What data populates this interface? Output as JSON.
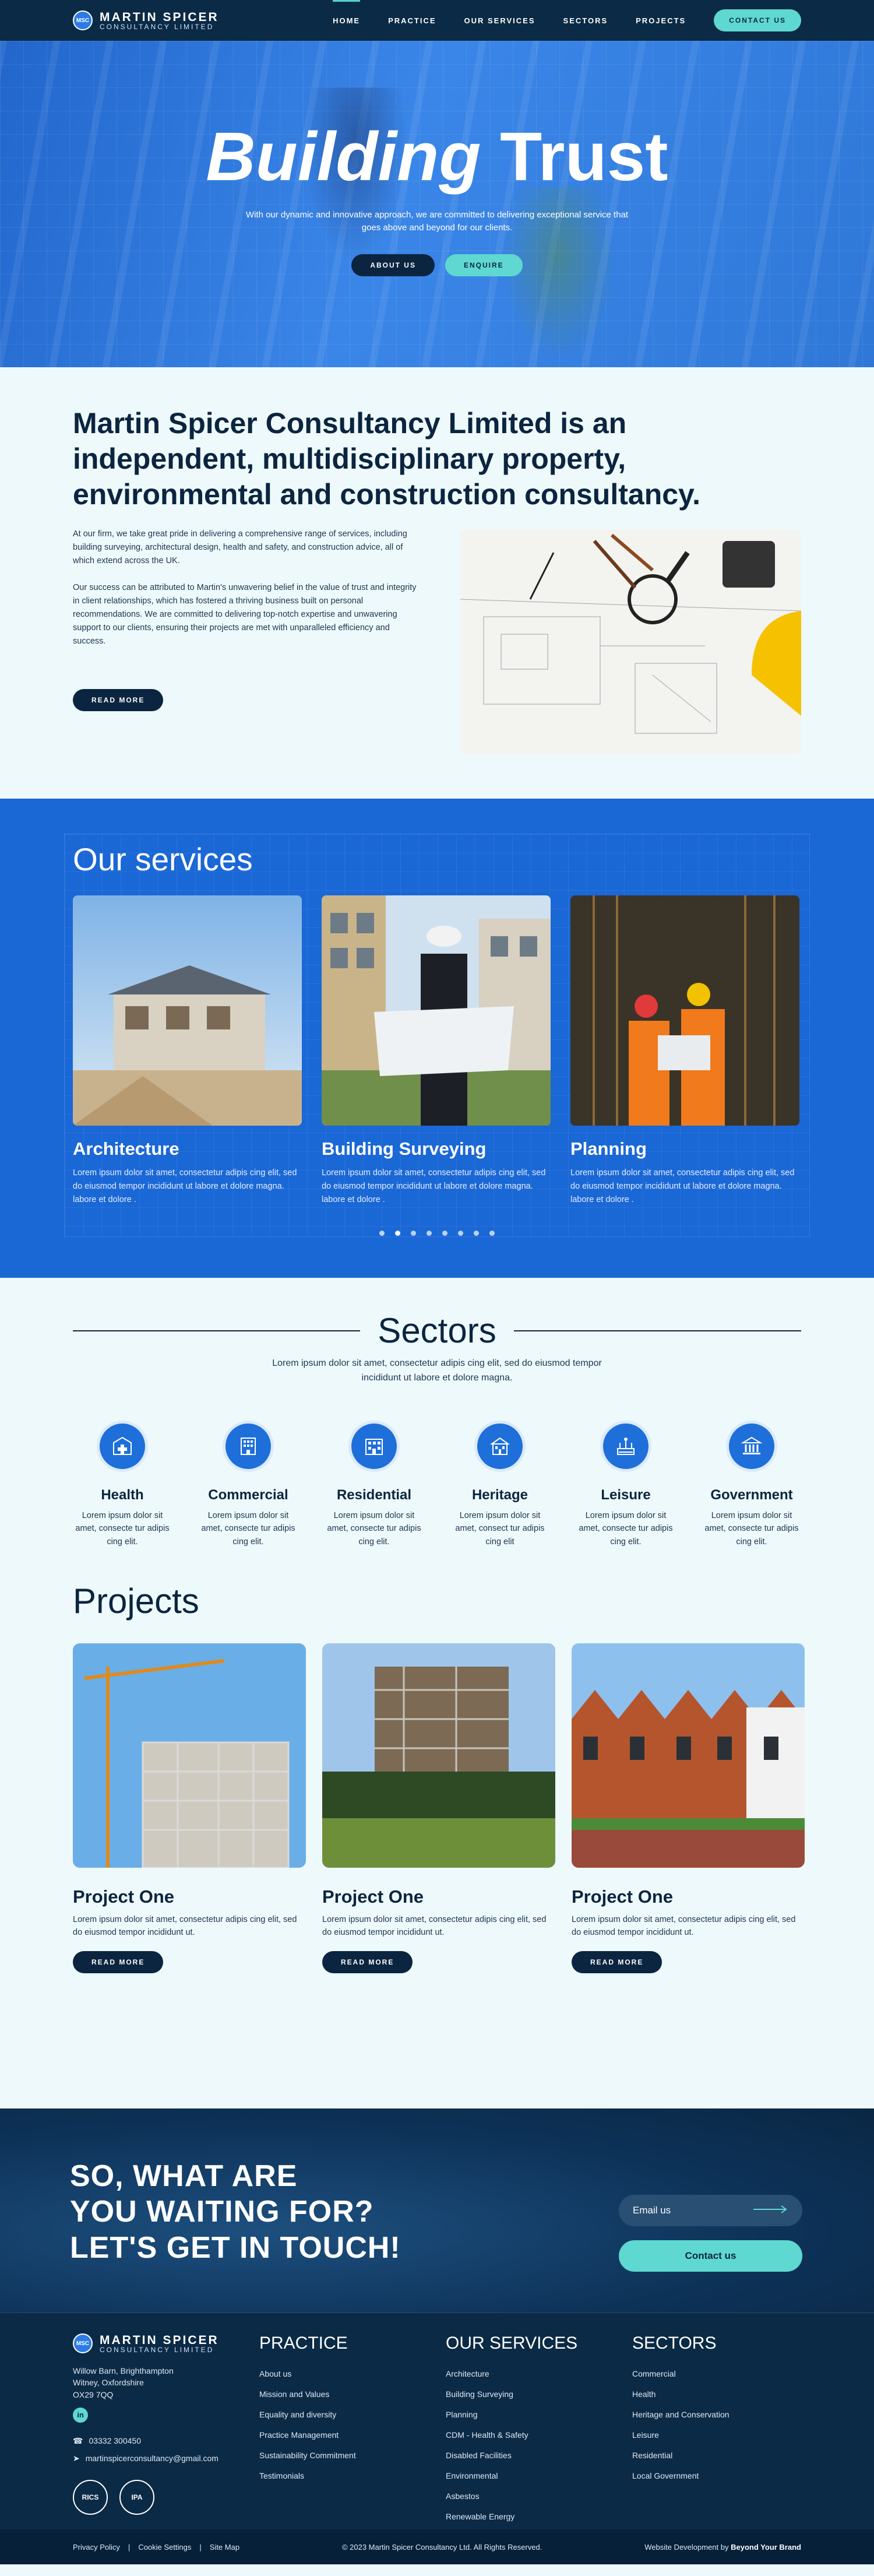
{
  "header": {
    "logo_badge": "MSC",
    "logo_line1": "MARTIN SPICER",
    "logo_line2": "CONSULTANCY LIMITED",
    "nav": [
      "HOME",
      "PRACTICE",
      "OUR SERVICES",
      "SECTORS",
      "PROJECTS"
    ],
    "contact_button": "CONTACT US"
  },
  "hero": {
    "title_italic": "Building",
    "title_rest": "Trust",
    "subtitle": "With our dynamic and innovative approach, we are committed to delivering exceptional service that goes above and beyond for our clients.",
    "button_about": "ABOUT US",
    "button_enquire": "ENQUIRE"
  },
  "about": {
    "heading": "Martin Spicer Consultancy Limited is an independent, multidisciplinary property, environmental and construction consultancy.",
    "para1": "At our firm, we take great pride in delivering a comprehensive range of services, including building surveying, architectural design, health and safety, and construction advice, all of which extend across the UK.",
    "para2": "Our success can be attributed to Martin's unwavering belief in the value of trust and integrity in client relationships, which has fostered a thriving business built on personal recommendations. We are committed to delivering top-notch expertise and unwavering support to our clients, ensuring their projects are met with unparalleled efficiency and success.",
    "read_more": "READ MORE"
  },
  "services": {
    "heading": "Our services",
    "items": [
      {
        "title": "Architecture",
        "text": "Lorem ipsum dolor sit amet, consectetur adipis cing elit, sed do eiusmod tempor incididunt ut labore et dolore magna. labore et dolore ."
      },
      {
        "title": "Building Surveying",
        "text": "Lorem ipsum dolor sit amet, consectetur adipis cing elit, sed do eiusmod tempor incididunt ut labore et dolore magna. labore et dolore ."
      },
      {
        "title": "Planning",
        "text": "Lorem ipsum dolor sit amet, consectetur adipis cing elit, sed do eiusmod tempor incididunt ut labore et dolore magna. labore et dolore ."
      }
    ],
    "active_dot": 1
  },
  "sectors": {
    "heading": "Sectors",
    "subtitle": "Lorem ipsum dolor sit amet, consectetur adipis cing elit, sed do eiusmod tempor incididunt ut labore et dolore magna.",
    "items": [
      {
        "title": "Health",
        "text": "Lorem ipsum dolor sit amet, consecte tur adipis cing elit.",
        "icon": "health-icon"
      },
      {
        "title": "Commercial",
        "text": "Lorem ipsum dolor sit amet, consecte tur adipis cing elit.",
        "icon": "commercial-icon"
      },
      {
        "title": "Residential",
        "text": "Lorem ipsum dolor sit amet, consecte tur adipis cing elit.",
        "icon": "residential-icon"
      },
      {
        "title": "Heritage",
        "text": "Lorem ipsum dolor sit amet, consect tur adipis cing elit",
        "icon": "heritage-icon"
      },
      {
        "title": "Leisure",
        "text": "Lorem ipsum dolor sit amet, consecte tur adipis cing elit.",
        "icon": "leisure-icon"
      },
      {
        "title": "Government",
        "text": "Lorem ipsum dolor sit amet, consecte tur adipis cing elit.",
        "icon": "government-icon"
      }
    ]
  },
  "projects": {
    "heading": "Projects",
    "items": [
      {
        "title": "Project One",
        "text": "Lorem ipsum dolor sit amet, consectetur adipis cing elit, sed do eiusmod tempor incididunt ut.",
        "button": "READ MORE"
      },
      {
        "title": "Project One",
        "text": "Lorem ipsum dolor sit amet, consectetur adipis cing elit, sed do eiusmod tempor incididunt ut.",
        "button": "READ MORE"
      },
      {
        "title": "Project One",
        "text": "Lorem ipsum dolor sit amet, consectetur adipis cing elit, sed do eiusmod tempor incididunt ut.",
        "button": "READ MORE"
      }
    ]
  },
  "cta": {
    "line1": "SO, WHAT ARE",
    "line2": "YOU WAITING FOR?",
    "line3": "LET'S GET IN TOUCH!",
    "email_placeholder": "Email us",
    "contact_button": "Contact us"
  },
  "footer": {
    "address": [
      "Willow Barn, Brighthampton",
      "Witney, Oxfordshire",
      "OX29 7QQ"
    ],
    "social": "in",
    "phone": "03332 300450",
    "email": "martinspicerconsultancy@gmail.com",
    "badge1": "RICS",
    "badge2": "IPA",
    "practice": {
      "heading": "PRACTICE",
      "items": [
        "About us",
        "Mission and Values",
        "Equality and diversity",
        "Practice Management",
        "Sustainability Commitment",
        "Testimonials"
      ]
    },
    "services": {
      "heading": "OUR SERVICES",
      "items": [
        "Architecture",
        "Building Surveying",
        "Planning",
        "CDM - Health & Safety",
        "Disabled Facilities",
        "Environmental",
        "Asbestos",
        "Renewable Energy"
      ]
    },
    "sectors": {
      "heading": "SECTORS",
      "items": [
        "Commercial",
        "Health",
        "Heritage and Conservation",
        "Leisure",
        "Residential",
        "Local Government"
      ]
    },
    "bottom_links": [
      "Privacy Policy",
      "Cookie Settings",
      "Site Map"
    ],
    "copyright": "© 2023 Martin Spicer Consultancy Ltd. All Rights Reserved.",
    "credit_prefix": "Website Development by",
    "credit_brand": "Beyond Your Brand"
  }
}
